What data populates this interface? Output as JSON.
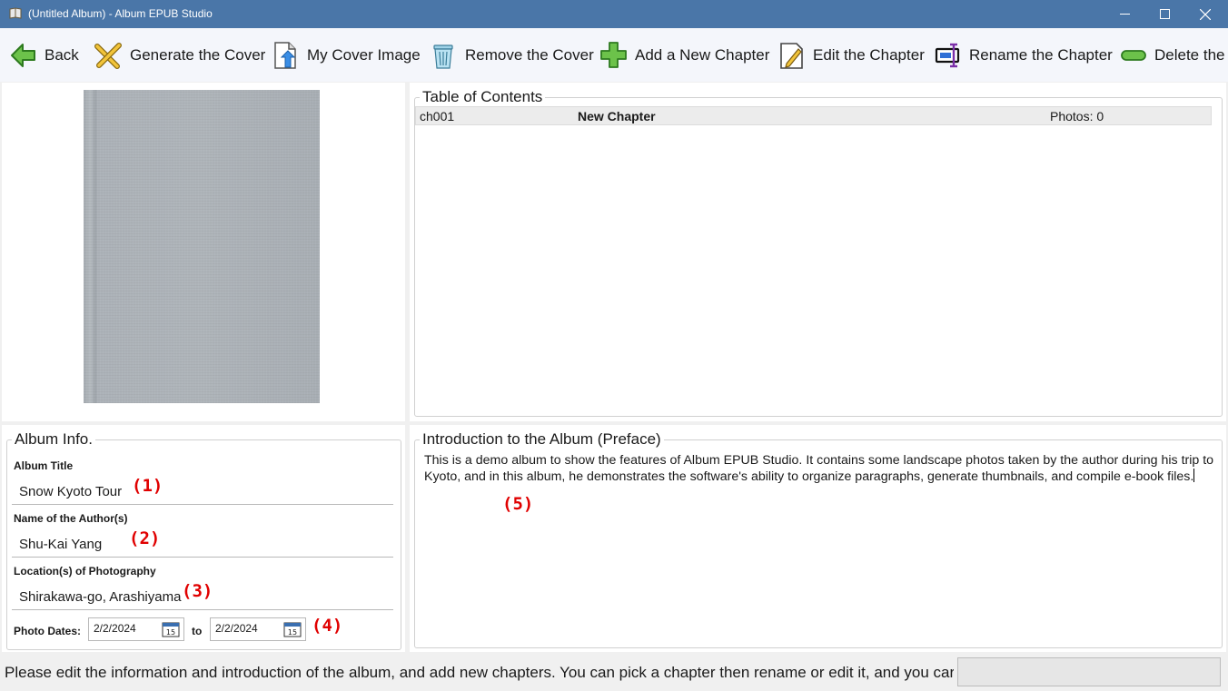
{
  "window": {
    "title": "(Untitled Album) - Album EPUB Studio",
    "controls": [
      "minimize",
      "maximize",
      "close"
    ]
  },
  "toolbar": {
    "items": [
      {
        "label": "Back",
        "icon": "back-arrow-icon"
      },
      {
        "label": "Generate the Cover",
        "icon": "cross-tools-icon"
      },
      {
        "label": "My Cover Image",
        "icon": "upload-file-icon"
      },
      {
        "label": "Remove the Cover",
        "icon": "trash-icon"
      },
      {
        "label": "Add a New Chapter",
        "icon": "plus-icon"
      },
      {
        "label": "Edit the Chapter",
        "icon": "edit-note-icon"
      },
      {
        "label": "Rename the Chapter",
        "icon": "rename-icon"
      },
      {
        "label": "Delete the",
        "icon": "minus-icon"
      }
    ]
  },
  "toc": {
    "title": "Table of Contents",
    "rows": [
      {
        "id": "ch001",
        "name": "New Chapter",
        "photos": "Photos: 0"
      }
    ]
  },
  "album_info": {
    "title": "Album Info.",
    "fields": [
      {
        "label": "Album Title",
        "value": "Snow Kyoto Tour",
        "marker": "(1)"
      },
      {
        "label": "Name of the Author(s)",
        "value": "Shu-Kai Yang",
        "marker": "(2)"
      },
      {
        "label": "Location(s) of Photography",
        "value": "Shirakawa-go, Arashiyama",
        "marker": "(3)"
      }
    ],
    "dates": {
      "label": "Photo Dates:",
      "from": "2/2/2024",
      "to_label": "to",
      "to": "2/2/2024",
      "calendar_day": "15",
      "marker": "(4)"
    }
  },
  "preface": {
    "title": "Introduction to the Album (Preface)",
    "text": "This is a demo album to show the features of Album EPUB Studio. It contains some landscape photos taken by the author during his trip to Kyoto, and in this album, he demonstrates the software's ability to organize paragraphs, generate thumbnails, and compile e-book files.",
    "marker": "(5)"
  },
  "status": {
    "text": "Please edit the information and introduction of the album, and add new chapters. You can pick a chapter then rename or edit it, and you car"
  },
  "colors": {
    "titlebar": "#4a76a8",
    "toolbar_bg": "#f4f6fb",
    "marker": "#e00000",
    "toc_row_bg": "#ececec"
  }
}
